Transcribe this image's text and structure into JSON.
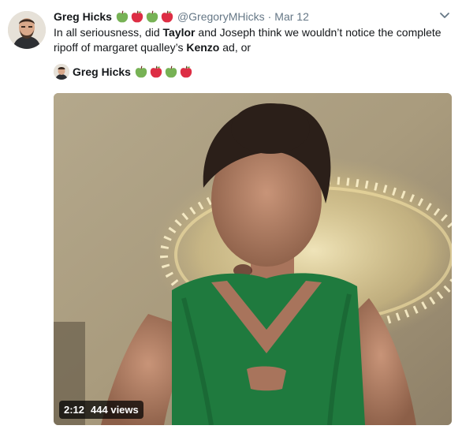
{
  "author": {
    "name": "Greg Hicks",
    "handle": "@GregoryMHicks",
    "separator": "·",
    "date": "Mar 12",
    "name_emojis": [
      "green-apple",
      "red-apple",
      "green-apple",
      "red-apple"
    ]
  },
  "tweet": {
    "text_before_1": "In all seriousness, did ",
    "bold_1": "Taylor",
    "text_between": " and Joseph think we wouldn’t notice the complete ripoff of margaret qualley’s ",
    "bold_2": "Kenzo",
    "text_after": " ad, or"
  },
  "tagged_user": {
    "name": "Greg Hicks",
    "name_emojis": [
      "green-apple",
      "red-apple",
      "green-apple",
      "red-apple"
    ]
  },
  "video": {
    "duration": "2:12",
    "views": "444 views"
  },
  "icons": {
    "menu": "chevron-down-icon"
  },
  "colors": {
    "text_primary": "#14171a",
    "text_secondary": "#657786",
    "apple_green": "#77b255",
    "apple_red": "#dd2e44",
    "dress_green": "#1f7a3e"
  }
}
